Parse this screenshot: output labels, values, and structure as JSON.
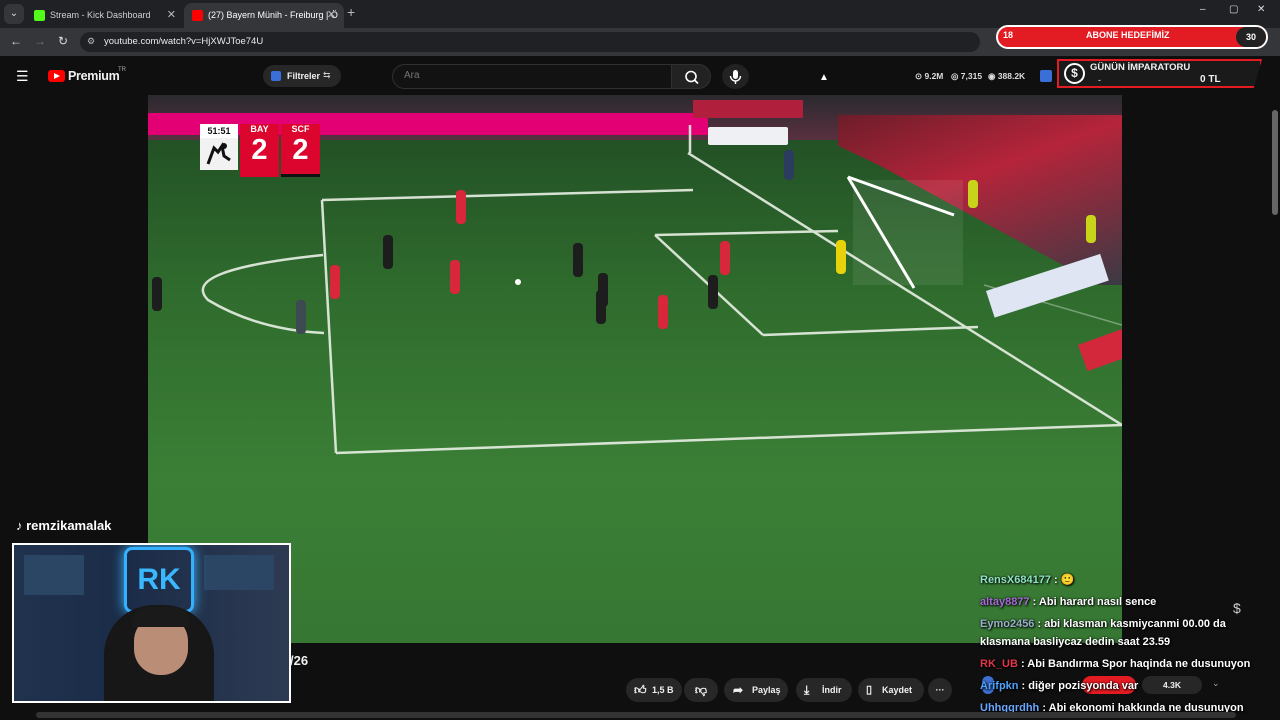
{
  "browser": {
    "tabs": [
      {
        "label": "Stream - Kick Dashboard",
        "favicon_color": "#53fc18"
      },
      {
        "label": "(27) Bayern Münih - Freiburg | Ö",
        "favicon_color": "#ff0000"
      }
    ],
    "new_tab": "+",
    "window_controls": [
      "–",
      "▢",
      "✕"
    ],
    "url": "youtube.com/watch?v=HjXWJToe74U"
  },
  "abone": {
    "count": "18",
    "title": "ABONE HEDEFİMİZ",
    "goal": "30"
  },
  "youtube": {
    "logo_text": "Premium",
    "region": "TR",
    "filters_label": "Filtreler",
    "search_placeholder": "Ara"
  },
  "stats": {
    "views": "9.2M",
    "viewers": "7,315",
    "likes": "388.2K"
  },
  "imparator": {
    "title": "GÜNÜN İMPARATORU",
    "name": "-",
    "amount": "0 TL"
  },
  "scoreboard": {
    "time": "51:51",
    "home": "BAY",
    "home_score": "2",
    "away": "SCF",
    "away_score": "2"
  },
  "webcam": {
    "handle": "remzikamalak",
    "sign": "RK"
  },
  "video_below": {
    "title_fragment": "/26",
    "like_count": "1,5 B",
    "share_label": "Paylaş",
    "download_label": "İndir",
    "save_label": "Kaydet",
    "more_label": "···"
  },
  "chat": [
    {
      "user": "RensX684177",
      "user_color": "#8fe3c4",
      "text": "🙂"
    },
    {
      "user": "altay8877",
      "user_color": "#a56ad6",
      "text": "Abi harard nasıl sence"
    },
    {
      "user": "Eymo2456",
      "user_color": "#9ab0c8",
      "text": "abi klasman kasmiycanmi 00.00 da"
    },
    {
      "user": "",
      "user_color": "#ffffff",
      "text": "klasmana basliycaz dedin saat 23.59"
    },
    {
      "user": "RK_UB",
      "user_color": "#e0374a",
      "text": "Abi Bandırma Spor haqinda ne dusunuyon"
    },
    {
      "user": "Arifpkn",
      "user_color": "#4fa3ff",
      "text": "diğer pozisyonda var"
    },
    {
      "user": "Uhhggrdhh",
      "user_color": "#6aa8ff",
      "text": "Abi ekonomi hakkında ne dusunuyon"
    }
  ],
  "chat_pill_value": "4.3K"
}
